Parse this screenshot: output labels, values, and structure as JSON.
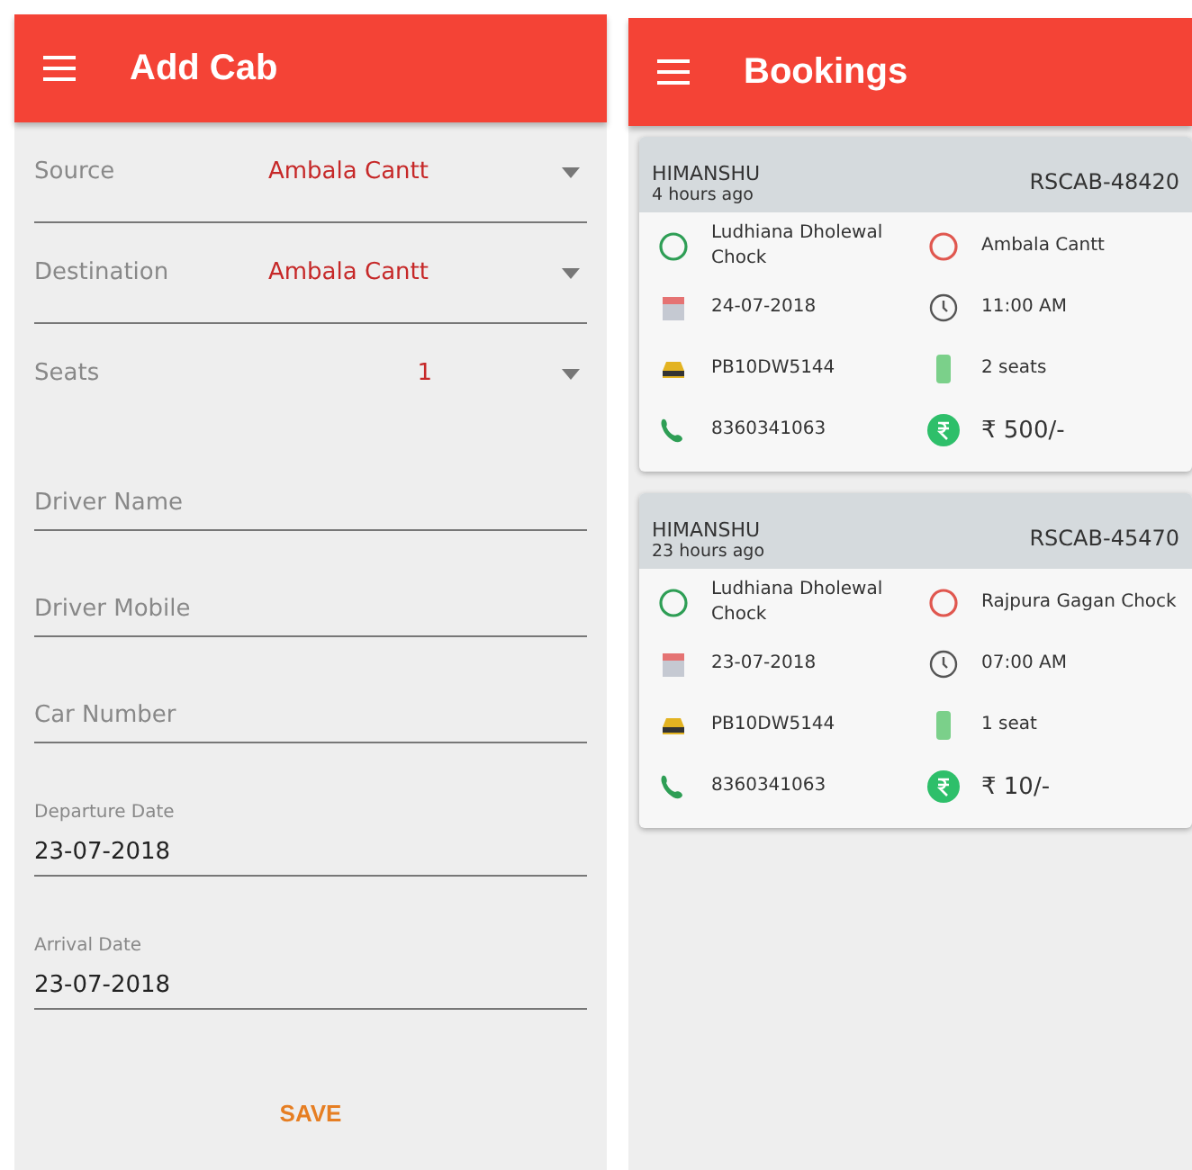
{
  "add_cab": {
    "title": "Add Cab",
    "fields": [
      {
        "kind": "dropdown",
        "label": "Source",
        "value": "Ambala Cantt"
      },
      {
        "kind": "dropdown",
        "label": "Destination",
        "value": "Ambala Cantt"
      },
      {
        "kind": "seats",
        "label": "Seats",
        "value": "1"
      },
      {
        "kind": "text",
        "placeholder": "Driver Name"
      },
      {
        "kind": "text",
        "placeholder": "Driver Mobile"
      },
      {
        "kind": "text",
        "placeholder": "Car Number"
      },
      {
        "kind": "date",
        "label": "Departure Date",
        "value": "23-07-2018"
      },
      {
        "kind": "date",
        "label": "Arrival Date",
        "value": "23-07-2018"
      }
    ],
    "save_button": "SAVE"
  },
  "bookings": {
    "title": "Bookings",
    "cards": [
      {
        "name": "HIMANSHU",
        "time_ago": "4 hours ago",
        "booking_id": "RSCAB-48420",
        "from": "Ludhiana Dholewal Chock",
        "to": "Ambala Cantt",
        "date": "24-07-2018",
        "time": "11:00 AM",
        "car_number": "PB10DW5144",
        "seats": "2 seats",
        "phone": "8360341063",
        "fare": "₹ 500/-"
      },
      {
        "name": "HIMANSHU",
        "time_ago": "23 hours ago",
        "booking_id": "RSCAB-45470",
        "from": "Ludhiana Dholewal Chock",
        "to": "Rajpura Gagan Chock",
        "date": "23-07-2018",
        "time": "07:00 AM",
        "car_number": "PB10DW5144",
        "seats": "1 seat",
        "phone": "8360341063",
        "fare": "₹ 10/-"
      }
    ]
  }
}
